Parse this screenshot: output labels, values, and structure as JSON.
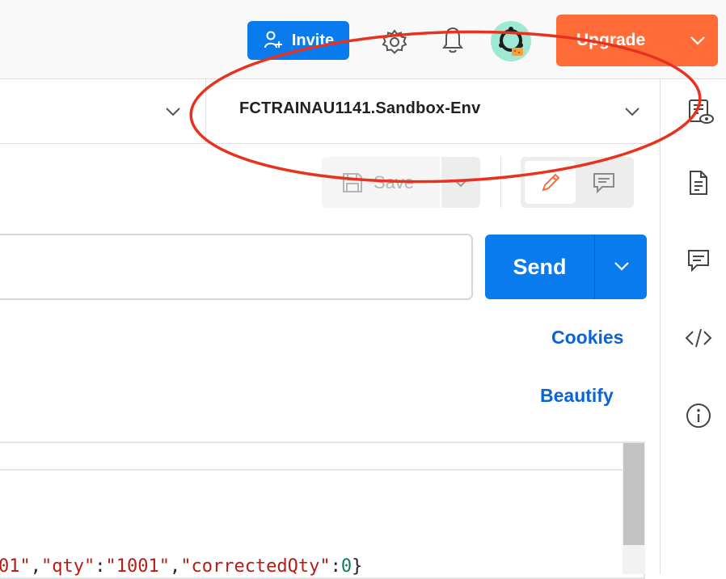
{
  "header": {
    "invite_label": "Invite",
    "upgrade_label": "Upgrade"
  },
  "environment": {
    "name": "FCTRAINAU1141.Sandbox-Env"
  },
  "request": {
    "save_label": "Save",
    "url_value": "",
    "send_label": "Send",
    "cookies_label": "Cookies",
    "beautify_label": "Beautify"
  },
  "editor": {
    "code_tokens": [
      {
        "t": "01\"",
        "c": "str"
      },
      {
        "t": ",",
        "c": "pun"
      },
      {
        "t": "\"qty\"",
        "c": "str"
      },
      {
        "t": ":",
        "c": "pun"
      },
      {
        "t": "\"1001\"",
        "c": "str"
      },
      {
        "t": ",",
        "c": "pun"
      },
      {
        "t": "\"correctedQty\"",
        "c": "str"
      },
      {
        "t": ":",
        "c": "pun"
      },
      {
        "t": "0",
        "c": "num"
      },
      {
        "t": "}",
        "c": "pun"
      }
    ]
  },
  "colors": {
    "primary": "#097bed",
    "upgrade": "#ff6c37",
    "annotation": "#e8321f"
  }
}
